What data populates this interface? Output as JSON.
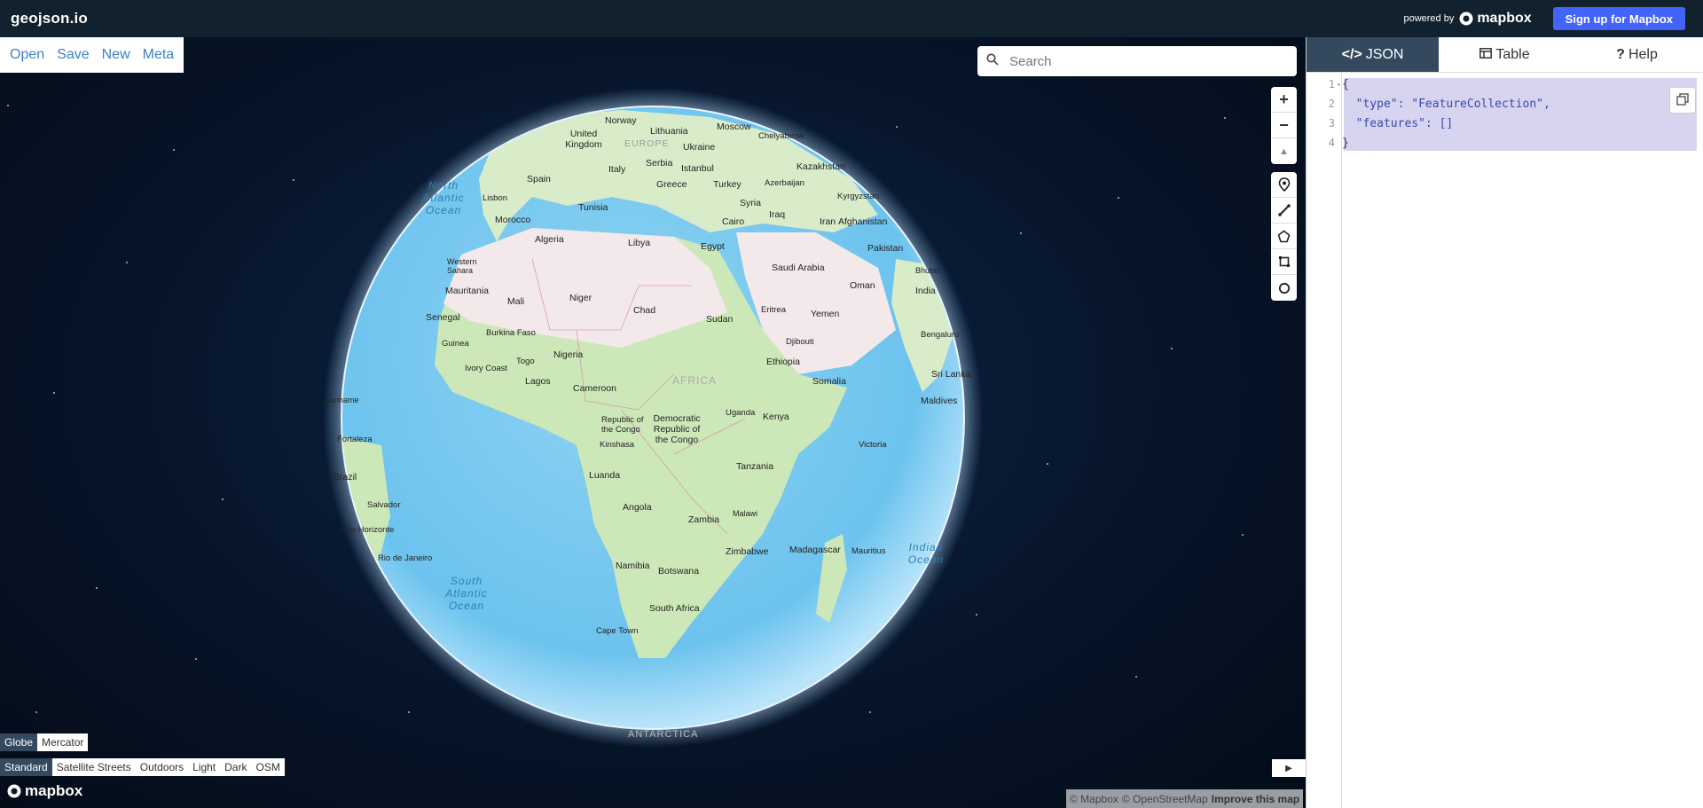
{
  "app": {
    "brand": "geojson.io",
    "powered_by": "powered by",
    "powered_logo": "mapbox",
    "signup": "Sign up for Mapbox"
  },
  "file_menu": {
    "open": "Open",
    "save": "Save",
    "new": "New",
    "meta": "Meta"
  },
  "search": {
    "placeholder": "Search",
    "icon": "search-icon"
  },
  "map_controls": {
    "zoom_in": "+",
    "zoom_out": "−",
    "compass": "▲"
  },
  "draw_tools": [
    {
      "name": "marker-icon"
    },
    {
      "name": "line-icon"
    },
    {
      "name": "polygon-icon"
    },
    {
      "name": "rectangle-icon"
    },
    {
      "name": "circle-icon"
    }
  ],
  "projections": {
    "globe": "Globe",
    "mercator": "Mercator",
    "active": "Globe"
  },
  "styles": {
    "items": [
      "Standard",
      "Satellite Streets",
      "Outdoors",
      "Light",
      "Dark",
      "OSM"
    ],
    "active": "Standard"
  },
  "footer": {
    "mapbox": "mapbox",
    "attribution_mapbox": "© Mapbox",
    "attribution_osm": "© OpenStreetMap",
    "improve": "Improve this map"
  },
  "globe_labels": [
    {
      "text": "Norway"
    },
    {
      "text": "Moscow"
    },
    {
      "text": "Lithuania"
    },
    {
      "text": "United Kingdom"
    },
    {
      "text": "EUROPE"
    },
    {
      "text": "Ukraine"
    },
    {
      "text": "Chelyabinsk"
    },
    {
      "text": "Serbia"
    },
    {
      "text": "Spain"
    },
    {
      "text": "Italy"
    },
    {
      "text": "Istanbul"
    },
    {
      "text": "Kazakhstan"
    },
    {
      "text": "Azerbaijan"
    },
    {
      "text": "Lisbon"
    },
    {
      "text": "Greece"
    },
    {
      "text": "Turkey"
    },
    {
      "text": "Kyrgyzstan"
    },
    {
      "text": "North Atlantic Ocean"
    },
    {
      "text": "Tunisia"
    },
    {
      "text": "Syria"
    },
    {
      "text": "Iraq"
    },
    {
      "text": "Morocco"
    },
    {
      "text": "Cairo"
    },
    {
      "text": "Iran"
    },
    {
      "text": "Afghanistan"
    },
    {
      "text": "Algeria"
    },
    {
      "text": "Libya"
    },
    {
      "text": "Egypt"
    },
    {
      "text": "Pakistan"
    },
    {
      "text": "Western Sahara"
    },
    {
      "text": "Saudi Arabia"
    },
    {
      "text": "Bhutan"
    },
    {
      "text": "Mauritania"
    },
    {
      "text": "Oman"
    },
    {
      "text": "India"
    },
    {
      "text": "Mali"
    },
    {
      "text": "Niger"
    },
    {
      "text": "Chad"
    },
    {
      "text": "Senegal"
    },
    {
      "text": "Yemen"
    },
    {
      "text": "Eritrea"
    },
    {
      "text": "Sudan"
    },
    {
      "text": "Burkina Faso"
    },
    {
      "text": "Guinea"
    },
    {
      "text": "Bengaluru"
    },
    {
      "text": "Djibouti"
    },
    {
      "text": "Nigeria"
    },
    {
      "text": "Ethiopia"
    },
    {
      "text": "Togo"
    },
    {
      "text": "Ivory Coast"
    },
    {
      "text": "Sri Lanka"
    },
    {
      "text": "Lagos"
    },
    {
      "text": "AFRICA"
    },
    {
      "text": "Somalia"
    },
    {
      "text": "Cameroon"
    },
    {
      "text": "Maldives"
    },
    {
      "text": "Suriname"
    },
    {
      "text": "Uganda"
    },
    {
      "text": "Democratic Republic of the Congo"
    },
    {
      "text": "Republic of the Congo"
    },
    {
      "text": "Kenya"
    },
    {
      "text": "Fortaleza"
    },
    {
      "text": "Kinshasa"
    },
    {
      "text": "Victoria"
    },
    {
      "text": "Brazil"
    },
    {
      "text": "Luanda"
    },
    {
      "text": "Tanzania"
    },
    {
      "text": "Salvador"
    },
    {
      "text": "Angola"
    },
    {
      "text": "Malawi"
    },
    {
      "text": "Zambia"
    },
    {
      "text": "Belo Horizonte"
    },
    {
      "text": "Rio de Janeiro"
    },
    {
      "text": "Zimbabwe"
    },
    {
      "text": "Madagascar"
    },
    {
      "text": "Mauritius"
    },
    {
      "text": "Indian Ocean"
    },
    {
      "text": "South Atlantic Ocean"
    },
    {
      "text": "Namibia"
    },
    {
      "text": "Botswana"
    },
    {
      "text": "South Africa"
    },
    {
      "text": "Cape Town"
    },
    {
      "text": "ANTARCTICA"
    }
  ],
  "panel": {
    "tabs": [
      "JSON",
      "Table",
      "Help"
    ],
    "active_tab": "JSON",
    "tab_icons": [
      "code-icon",
      "table-icon",
      "help-icon"
    ],
    "code_lines": [
      {
        "num": "1",
        "text": "{"
      },
      {
        "num": "2",
        "text": "  \"type\": \"FeatureCollection\","
      },
      {
        "num": "3",
        "text": "  \"features\": []"
      },
      {
        "num": "4",
        "text": "}"
      }
    ]
  },
  "colors": {
    "topbar": "#11212d",
    "accent": "#4264fb",
    "active_tab": "#34495e",
    "json_highlight": "#d7d4f0"
  }
}
